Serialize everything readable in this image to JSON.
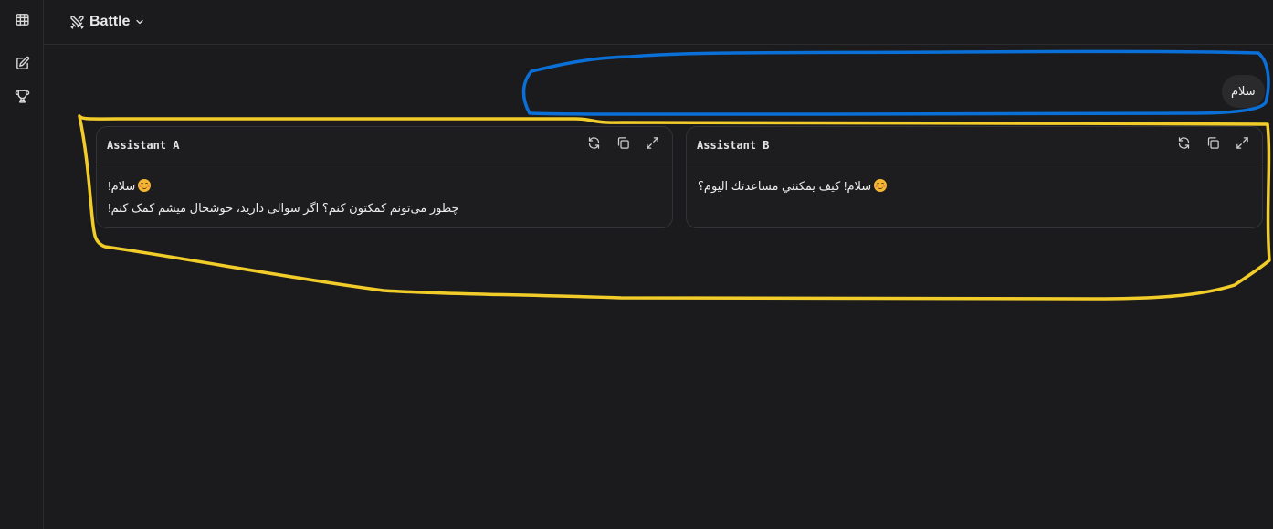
{
  "sidebar": {
    "items": [
      {
        "icon": "table-icon"
      },
      {
        "icon": "edit-icon"
      },
      {
        "icon": "trophy-icon"
      }
    ]
  },
  "header": {
    "mode_icon": "crossed-swords-icon",
    "mode_label": "Battle"
  },
  "conversation": {
    "user_message": "سلام",
    "responses": [
      {
        "title": "Assistant A",
        "lines": [
          {
            "text": "سلام!",
            "emoji": "smiling-face-icon"
          },
          {
            "text": "چطور می‌تونم کمکتون کنم؟ اگر سوالی دارید، خوشحال میشم کمک کنم!"
          }
        ],
        "actions": [
          "regenerate-icon",
          "copy-icon",
          "expand-icon"
        ]
      },
      {
        "title": "Assistant B",
        "lines": [
          {
            "text": "سلام! كيف يمكنني مساعدتك اليوم؟",
            "emoji": "smiling-face-icon"
          }
        ],
        "actions": [
          "regenerate-icon",
          "copy-icon",
          "expand-icon"
        ]
      }
    ]
  },
  "annotations": {
    "user_highlight_color": "#0a6fd6",
    "responses_highlight_color": "#f2cd2a"
  },
  "colors": {
    "background": "#1b1b1d",
    "border": "#333337",
    "text": "#ececec"
  }
}
